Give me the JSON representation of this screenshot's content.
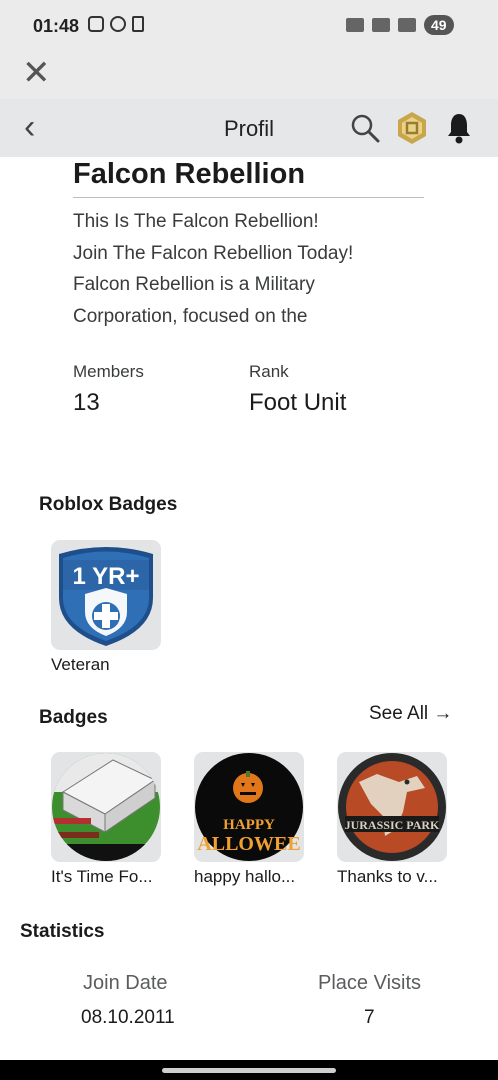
{
  "status_bar": {
    "time": "01:48",
    "battery": "49"
  },
  "header": {
    "title": "Profil"
  },
  "group": {
    "name": "Falcon Rebellion",
    "description_lines": [
      "This Is The Falcon Rebellion!",
      "Join The Falcon Rebellion Today!",
      "Falcon Rebellion is a Military",
      "Corporation, focused on the"
    ],
    "members_label": "Members",
    "members_value": "13",
    "rank_label": "Rank",
    "rank_value": "Foot Unit"
  },
  "roblox_badges": {
    "title": "Roblox Badges",
    "items": [
      {
        "name": "Veteran",
        "badge_text": "1 YR+"
      }
    ]
  },
  "badges": {
    "title": "Badges",
    "see_all": "See All →",
    "items": [
      {
        "name": "It's Time Fo..."
      },
      {
        "name": "happy hallo...",
        "image_text_1": "HAPPY",
        "image_text_2": "ALLOWEE"
      },
      {
        "name": "Thanks to v...",
        "image_text": "JURASSIC PARK"
      }
    ]
  },
  "statistics": {
    "title": "Statistics",
    "join_date_label": "Join Date",
    "join_date_value": "08.10.2011",
    "place_visits_label": "Place Visits",
    "place_visits_value": "7"
  },
  "colors": {
    "badge_blue": "#2e6fb5",
    "tile_bg": "#e3e4e6",
    "pumpkin": "#e2761b"
  }
}
